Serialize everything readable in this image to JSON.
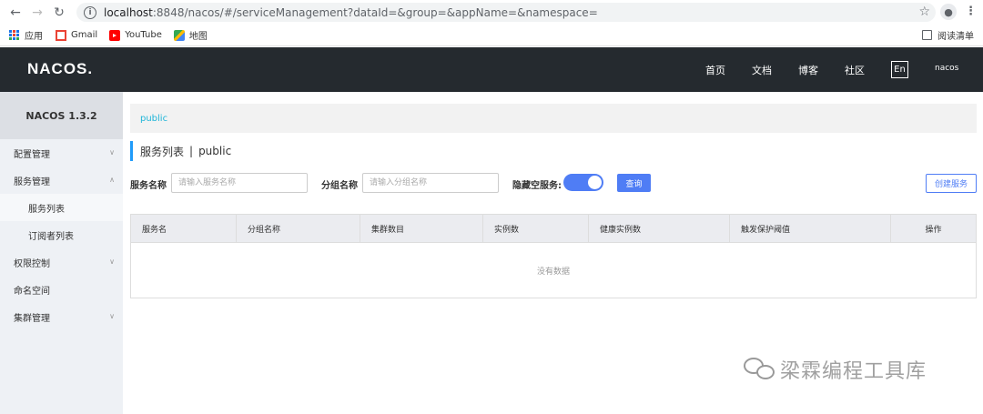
{
  "browser": {
    "url_host": "localhost",
    "url_rest": ":8848/nacos/#/serviceManagement?dataId=&group=&appName=&namespace=",
    "bookmarks": [
      {
        "label": "应用",
        "icon": "apps-grid-icon"
      },
      {
        "label": "Gmail",
        "icon": "gmail-icon"
      },
      {
        "label": "YouTube",
        "icon": "youtube-icon"
      },
      {
        "label": "地图",
        "icon": "maps-icon"
      }
    ],
    "reading_list": "阅读清单"
  },
  "header": {
    "logo": "NACOS.",
    "nav": [
      "首页",
      "文档",
      "博客",
      "社区"
    ],
    "lang": "En",
    "user": "nacos",
    "bg_color": "#252a2f"
  },
  "sidebar": {
    "title": "NACOS 1.3.2",
    "items": [
      {
        "label": "配置管理",
        "chevron": "down"
      },
      {
        "label": "服务管理",
        "chevron": "up"
      },
      {
        "label": "服务列表",
        "sub": true,
        "active": true
      },
      {
        "label": "订阅者列表",
        "sub": true
      },
      {
        "label": "权限控制",
        "chevron": "down"
      },
      {
        "label": "命名空间"
      },
      {
        "label": "集群管理",
        "chevron": "down"
      }
    ]
  },
  "main": {
    "breadcrumb": "public",
    "title": "服务列表",
    "title_sep": "|",
    "title_ns": "public",
    "filters": {
      "service_name_label": "服务名称",
      "service_name_placeholder": "请输入服务名称",
      "group_name_label": "分组名称",
      "group_name_placeholder": "请输入分组名称",
      "hide_empty_label": "隐藏空服务:",
      "hide_empty_on": true,
      "query_button": "查询"
    },
    "create_button": "创建服务",
    "table": {
      "columns": [
        "服务名",
        "分组名称",
        "集群数目",
        "实例数",
        "健康实例数",
        "触发保护阈值",
        "操作"
      ],
      "empty_text": "没有数据"
    },
    "accent_color": "#4f7df5"
  },
  "watermark": "梁霖编程工具库"
}
